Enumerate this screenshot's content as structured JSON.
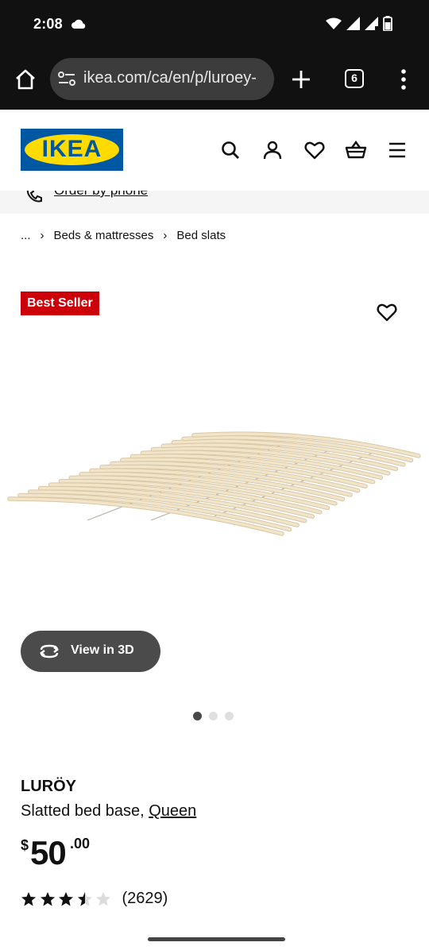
{
  "status_bar": {
    "time": "2:08"
  },
  "browser": {
    "url": "ikea.com/ca/en/p/luroey-",
    "tab_count": "6"
  },
  "header": {
    "logo_text": "IKEA",
    "brand_colors": {
      "blue": "#0058a3",
      "yellow": "#ffdb00"
    }
  },
  "promo": {
    "link_label": "Order by phone"
  },
  "breadcrumb": {
    "ellipsis": "...",
    "items": [
      "Beds & mattresses",
      "Bed slats"
    ]
  },
  "product": {
    "badge": "Best Seller",
    "badge_color": "#cc0008",
    "view_3d_label": "View in 3D",
    "image_dots": {
      "count": 3,
      "active_index": 0
    },
    "name": "LURÖY",
    "description": "Slatted bed base, ",
    "size_link": "Queen",
    "price": {
      "currency": "$",
      "integer": "50",
      "decimal": ".00"
    },
    "rating": {
      "stars": 3.5,
      "max": 5,
      "count_text": "(2629)"
    }
  }
}
